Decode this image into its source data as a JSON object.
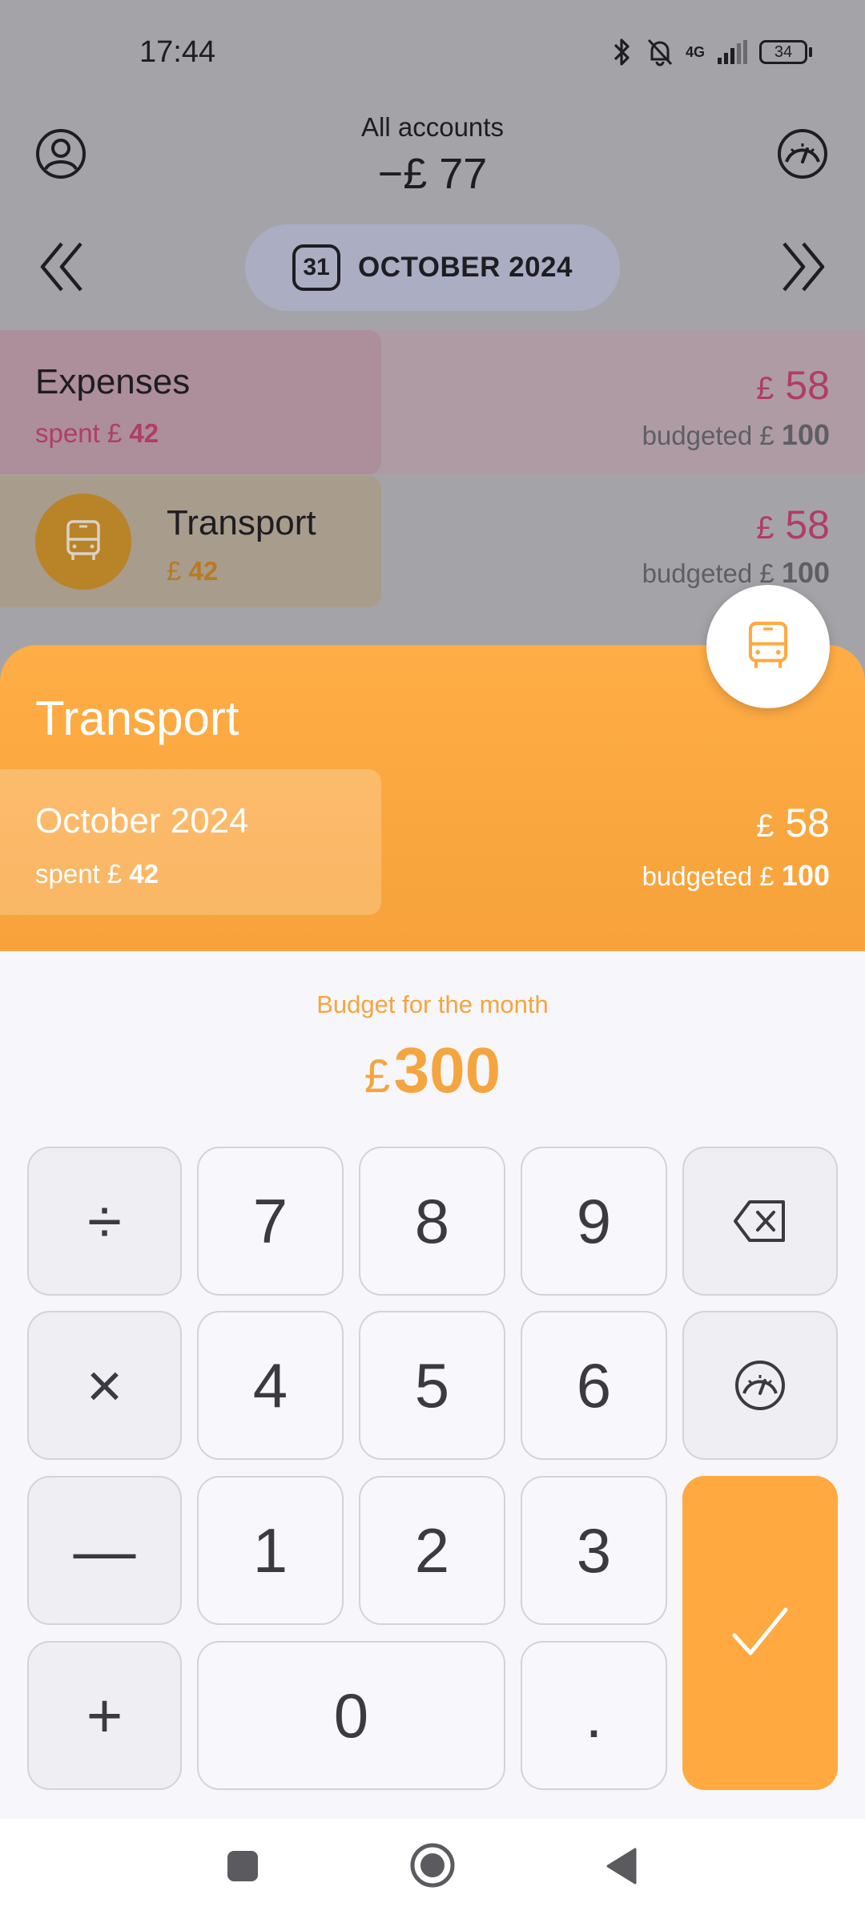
{
  "status_bar": {
    "time": "17:44",
    "network": "4G",
    "battery": "34"
  },
  "header": {
    "title": "All accounts",
    "total": "−£ 77",
    "month": "OCTOBER 2024",
    "calendar_day": "31"
  },
  "expenses_row": {
    "label": "Expenses",
    "spent_prefix": "spent £ ",
    "spent_value": "42",
    "left_currency": "£",
    "left_value": "58",
    "budgeted_prefix": "budgeted £ ",
    "budgeted_value": "100"
  },
  "transport_row": {
    "label": "Transport",
    "spent_prefix": "£ ",
    "spent_value": "42",
    "left_currency": "£",
    "left_value": "58",
    "budgeted_prefix": "budgeted £ ",
    "budgeted_value": "100",
    "icon": "bus-icon"
  },
  "sheet": {
    "title": "Transport",
    "period": "October 2024",
    "spent_prefix": "spent £ ",
    "spent_value": "42",
    "left_currency": "£",
    "left_value": "58",
    "budgeted_prefix": "budgeted £ ",
    "budgeted_value": "100"
  },
  "budget": {
    "label": "Budget for the month",
    "currency": "£",
    "value": "300"
  },
  "keypad": {
    "divide": "÷",
    "multiply": "×",
    "minus": "—",
    "plus": "+",
    "k7": "7",
    "k8": "8",
    "k9": "9",
    "k4": "4",
    "k5": "5",
    "k6": "6",
    "k1": "1",
    "k2": "2",
    "k3": "3",
    "k0": "0",
    "dot": "."
  },
  "colors": {
    "accent": "#ffa940",
    "expense_pink": "#b03d67",
    "keypad_bg": "#f7f6fa"
  }
}
